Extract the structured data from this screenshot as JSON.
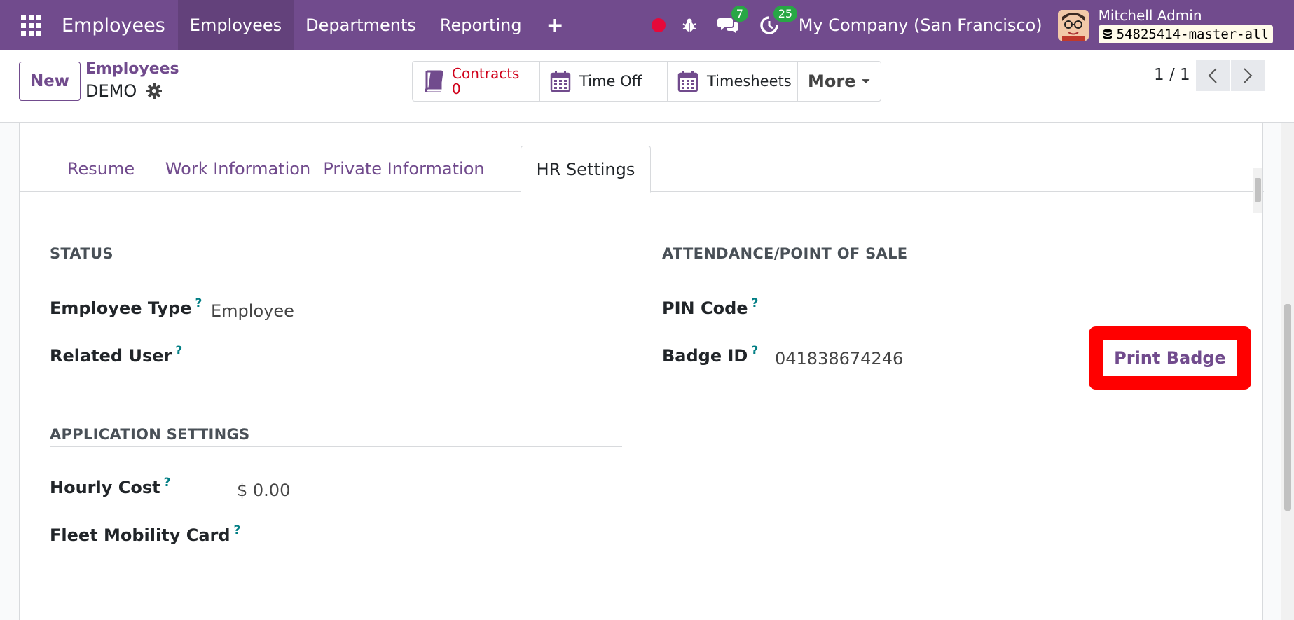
{
  "navbar": {
    "app_title": "Employees",
    "menu": [
      {
        "label": "Employees"
      },
      {
        "label": "Departments"
      },
      {
        "label": "Reporting"
      }
    ],
    "plus_label": "+",
    "messages_count": "7",
    "activities_count": "25",
    "company": "My Company (San Francisco)",
    "user_name": "Mitchell Admin",
    "db_name": "54825414-master-all"
  },
  "control": {
    "new_label": "New",
    "breadcrumb": "Employees",
    "record_name": "DEMO",
    "smart_buttons": {
      "contracts_label": "Contracts",
      "contracts_count": "0",
      "timeoff_label": "Time Off",
      "timesheets_label": "Timesheets",
      "more_label": "More"
    },
    "pager": "1 / 1"
  },
  "tabs": [
    {
      "label": "Resume"
    },
    {
      "label": "Work Information"
    },
    {
      "label": "Private Information"
    },
    {
      "label": "HR Settings"
    }
  ],
  "status": {
    "title": "STATUS",
    "employee_type_label": "Employee Type",
    "employee_type_value": "Employee",
    "related_user_label": "Related User"
  },
  "application": {
    "title": "APPLICATION SETTINGS",
    "hourly_cost_label": "Hourly Cost",
    "hourly_cost_value": "$ 0.00",
    "fleet_card_label": "Fleet Mobility Card"
  },
  "attendance": {
    "title": "ATTENDANCE/POINT OF SALE",
    "pin_label": "PIN Code",
    "badge_label": "Badge ID",
    "badge_value": "041838674246",
    "print_badge_label": "Print Badge"
  },
  "help_mark": "?",
  "colors": {
    "brand": "#714b8d",
    "highlight": "#ff0000",
    "badge_green": "#28a745",
    "help": "#017e84"
  }
}
